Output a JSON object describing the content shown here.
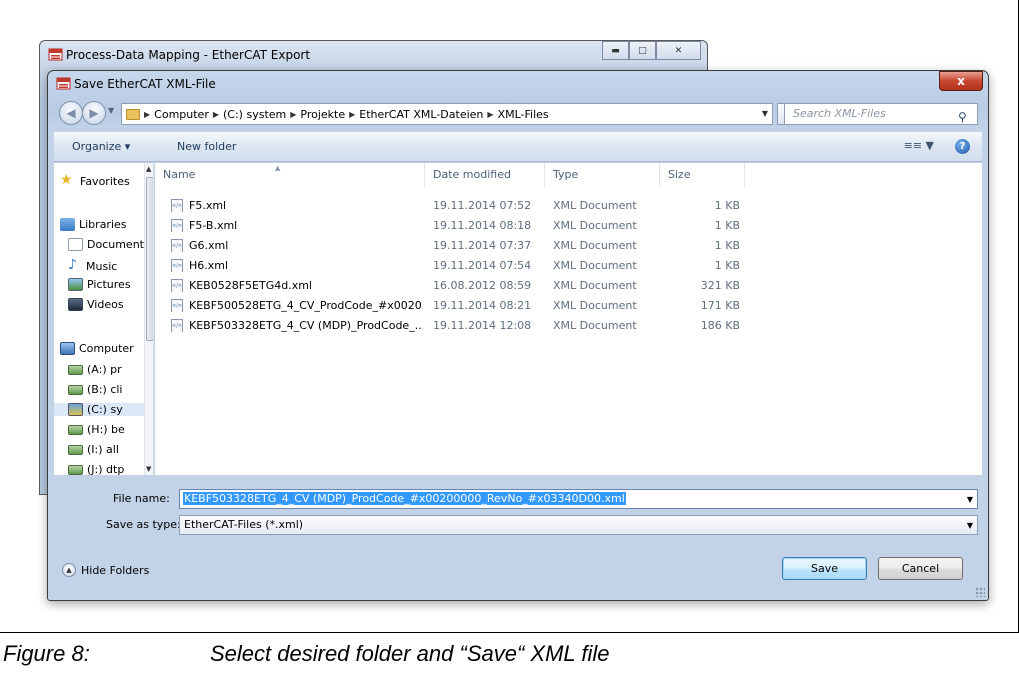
{
  "caption": {
    "label": "Figure 8:",
    "text": "Select desired folder and “Save“ XML file"
  },
  "background_window": {
    "title": "Process-Data Mapping - EtherCAT Export",
    "controls": [
      "minimize",
      "maximize",
      "close"
    ]
  },
  "dialog": {
    "title": "Save EtherCAT XML-File",
    "close_label": "x",
    "address": {
      "crumbs": [
        "Computer",
        "(C:) system",
        "Projekte",
        "EtherCAT XML-Dateien",
        "XML-Files"
      ]
    },
    "search": {
      "placeholder": "Search XML-Files"
    },
    "toolbar": {
      "organize_label": "Organize ▾",
      "new_folder_label": "New folder"
    },
    "nav": {
      "favorites": "Favorites",
      "libraries": "Libraries",
      "documents": "Documents",
      "music": "Music",
      "pictures": "Pictures",
      "videos": "Videos",
      "computer": "Computer",
      "drives": [
        "(A:) pr",
        "(B:) cli",
        "(C:) sy",
        "(H:) be",
        "(I:) all",
        "(J:) dtp"
      ]
    },
    "columns": {
      "name": "Name",
      "date": "Date modified",
      "type": "Type",
      "size": "Size"
    },
    "files": [
      {
        "name": "F5.xml",
        "date": "19.11.2014 07:52",
        "type": "XML Document",
        "size": "1 KB"
      },
      {
        "name": "F5-B.xml",
        "date": "19.11.2014 08:18",
        "type": "XML Document",
        "size": "1 KB"
      },
      {
        "name": "G6.xml",
        "date": "19.11.2014 07:37",
        "type": "XML Document",
        "size": "1 KB"
      },
      {
        "name": "H6.xml",
        "date": "19.11.2014 07:54",
        "type": "XML Document",
        "size": "1 KB"
      },
      {
        "name": "KEB0528F5ETG4d.xml",
        "date": "16.08.2012 08:59",
        "type": "XML Document",
        "size": "321 KB"
      },
      {
        "name": "KEBF500528ETG_4_CV_ProdCode_#x0020...",
        "date": "19.11.2014 08:21",
        "type": "XML Document",
        "size": "171 KB"
      },
      {
        "name": "KEBF503328ETG_4_CV (MDP)_ProdCode_...",
        "date": "19.11.2014 12:08",
        "type": "XML Document",
        "size": "186 KB"
      }
    ],
    "file_name_label": "File name:",
    "file_name_value": "KEBF503328ETG_4_CV (MDP)_ProdCode_#x00200000_RevNo_#x03340D00.xml",
    "save_type_label": "Save as type:",
    "save_type_value": "EtherCAT-Files (*.xml)",
    "hide_folders_label": "Hide Folders",
    "save_label": "Save",
    "cancel_label": "Cancel"
  },
  "colors": {
    "selection": "#3399ff",
    "close_button": "#c7472f",
    "link_text": "#1e395b"
  }
}
